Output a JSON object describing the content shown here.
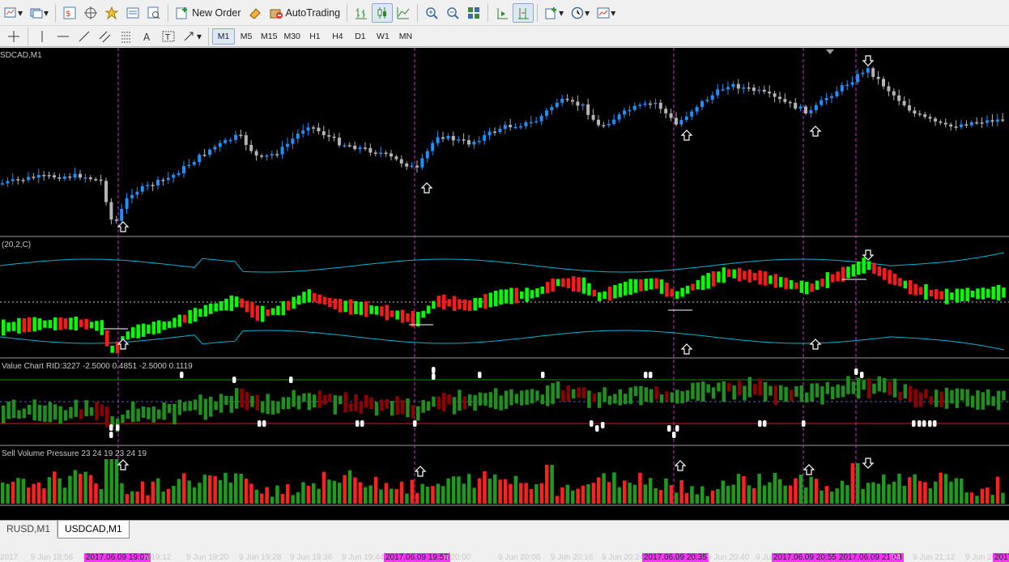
{
  "toolbar": {
    "new_order_label": "New Order",
    "autotrading_label": "AutoTrading"
  },
  "timeframes": [
    "M1",
    "M5",
    "M15",
    "M30",
    "H1",
    "H4",
    "D1",
    "W1",
    "MN"
  ],
  "active_timeframe": "M1",
  "panels": {
    "main_label": "SDCAD,M1",
    "bands_label": "(20,2,C)",
    "value_chart_label": "Value Chart RID:3227 -2.5000 0.4851 -2.5000 0.1119",
    "volume_label": "Sell Volume Pressure 23 24 19 23 24 19"
  },
  "time_labels": [
    {
      "text": "2017",
      "hl": false
    },
    {
      "text": "9 Jun 18:56",
      "hl": false
    },
    {
      "text": "2017.06.09 19:09",
      "hl": true
    },
    {
      "text": "n 19:12",
      "hl": false
    },
    {
      "text": "9 Jun 19:20",
      "hl": false
    },
    {
      "text": "9 Jun 19:28",
      "hl": false
    },
    {
      "text": "9 Jun 19:36",
      "hl": false
    },
    {
      "text": "9 Jun 19:44",
      "hl": false
    },
    {
      "text": "2017.06.09 19:55",
      "hl": true
    },
    {
      "text": "n 20:00",
      "hl": false
    },
    {
      "text": "9 Jun 20:08",
      "hl": false
    },
    {
      "text": "9 Jun 20:16",
      "hl": false
    },
    {
      "text": "9 Jun 20:24",
      "hl": false
    },
    {
      "text": "2017.06.09 20:35",
      "hl": true
    },
    {
      "text": "9 Jun 20:40",
      "hl": false
    },
    {
      "text": "9 Jun",
      "hl": false
    },
    {
      "text": "2017.06.09 20:55",
      "hl": true
    },
    {
      "text": "2017.06.09 21:03",
      "hl": true
    },
    {
      "text": ":04",
      "hl": false
    },
    {
      "text": "9 Jun 21:12",
      "hl": false
    },
    {
      "text": "9 Jun 2",
      "hl": false
    },
    {
      "text": "2017.0",
      "hl": true
    }
  ],
  "tabs": [
    "RUSD,M1",
    "USDCAD,M1"
  ],
  "active_tab": "USDCAD,M1",
  "colors": {
    "background": "#000000",
    "bull_candle": "#1e90ff",
    "bear_candle": "#b4b4b4",
    "bands_line": "#00b4d8",
    "histo_green": "#00ff00",
    "histo_red": "#ff1a1a",
    "value_green": "#1f8f1f",
    "value_red": "#8b0000",
    "marker_line": "#cc33cc",
    "highlight_label": "#ff33ff"
  }
}
